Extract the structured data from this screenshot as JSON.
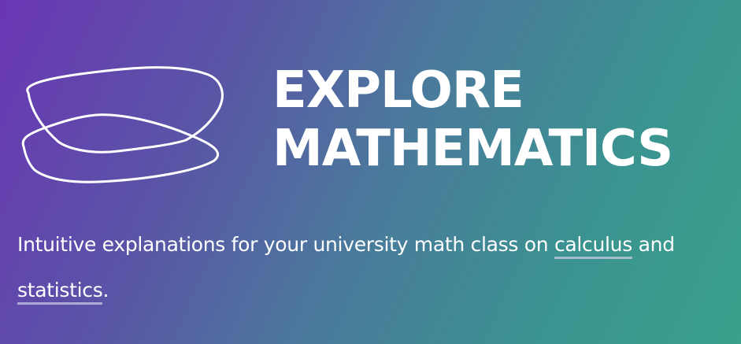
{
  "hero": {
    "title_line1": "EXPLORE",
    "title_line2": "MATHEMATICS",
    "tagline_prefix": "Intuitive explanations for your university math class on",
    "link_calculus": "calculus",
    "tagline_connector": "and",
    "link_statistics": "statistics",
    "tagline_suffix": "."
  },
  "logo": {
    "icon": "overlapping-loops-logo-icon",
    "stroke_color": "#ffffff"
  },
  "colors": {
    "gradient_start": "#6a36b4",
    "gradient_end": "#39a08a",
    "text": "#ffffff",
    "link_underline": "#c8c8e1"
  }
}
